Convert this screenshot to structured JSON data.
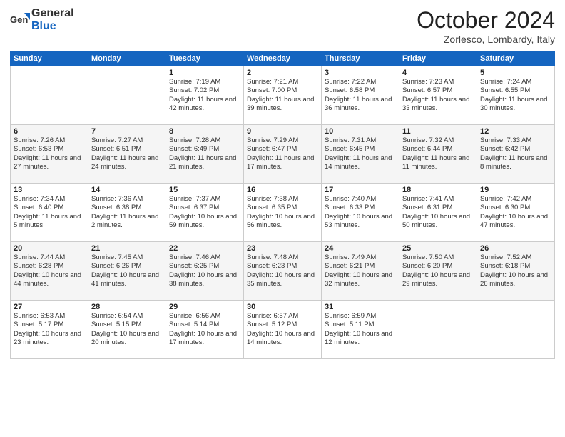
{
  "header": {
    "logo_line1": "General",
    "logo_line2": "Blue",
    "month": "October 2024",
    "location": "Zorlesco, Lombardy, Italy"
  },
  "days_of_week": [
    "Sunday",
    "Monday",
    "Tuesday",
    "Wednesday",
    "Thursday",
    "Friday",
    "Saturday"
  ],
  "weeks": [
    [
      {
        "day": "",
        "data": ""
      },
      {
        "day": "",
        "data": ""
      },
      {
        "day": "1",
        "data": "Sunrise: 7:19 AM\nSunset: 7:02 PM\nDaylight: 11 hours and 42 minutes."
      },
      {
        "day": "2",
        "data": "Sunrise: 7:21 AM\nSunset: 7:00 PM\nDaylight: 11 hours and 39 minutes."
      },
      {
        "day": "3",
        "data": "Sunrise: 7:22 AM\nSunset: 6:58 PM\nDaylight: 11 hours and 36 minutes."
      },
      {
        "day": "4",
        "data": "Sunrise: 7:23 AM\nSunset: 6:57 PM\nDaylight: 11 hours and 33 minutes."
      },
      {
        "day": "5",
        "data": "Sunrise: 7:24 AM\nSunset: 6:55 PM\nDaylight: 11 hours and 30 minutes."
      }
    ],
    [
      {
        "day": "6",
        "data": "Sunrise: 7:26 AM\nSunset: 6:53 PM\nDaylight: 11 hours and 27 minutes."
      },
      {
        "day": "7",
        "data": "Sunrise: 7:27 AM\nSunset: 6:51 PM\nDaylight: 11 hours and 24 minutes."
      },
      {
        "day": "8",
        "data": "Sunrise: 7:28 AM\nSunset: 6:49 PM\nDaylight: 11 hours and 21 minutes."
      },
      {
        "day": "9",
        "data": "Sunrise: 7:29 AM\nSunset: 6:47 PM\nDaylight: 11 hours and 17 minutes."
      },
      {
        "day": "10",
        "data": "Sunrise: 7:31 AM\nSunset: 6:45 PM\nDaylight: 11 hours and 14 minutes."
      },
      {
        "day": "11",
        "data": "Sunrise: 7:32 AM\nSunset: 6:44 PM\nDaylight: 11 hours and 11 minutes."
      },
      {
        "day": "12",
        "data": "Sunrise: 7:33 AM\nSunset: 6:42 PM\nDaylight: 11 hours and 8 minutes."
      }
    ],
    [
      {
        "day": "13",
        "data": "Sunrise: 7:34 AM\nSunset: 6:40 PM\nDaylight: 11 hours and 5 minutes."
      },
      {
        "day": "14",
        "data": "Sunrise: 7:36 AM\nSunset: 6:38 PM\nDaylight: 11 hours and 2 minutes."
      },
      {
        "day": "15",
        "data": "Sunrise: 7:37 AM\nSunset: 6:37 PM\nDaylight: 10 hours and 59 minutes."
      },
      {
        "day": "16",
        "data": "Sunrise: 7:38 AM\nSunset: 6:35 PM\nDaylight: 10 hours and 56 minutes."
      },
      {
        "day": "17",
        "data": "Sunrise: 7:40 AM\nSunset: 6:33 PM\nDaylight: 10 hours and 53 minutes."
      },
      {
        "day": "18",
        "data": "Sunrise: 7:41 AM\nSunset: 6:31 PM\nDaylight: 10 hours and 50 minutes."
      },
      {
        "day": "19",
        "data": "Sunrise: 7:42 AM\nSunset: 6:30 PM\nDaylight: 10 hours and 47 minutes."
      }
    ],
    [
      {
        "day": "20",
        "data": "Sunrise: 7:44 AM\nSunset: 6:28 PM\nDaylight: 10 hours and 44 minutes."
      },
      {
        "day": "21",
        "data": "Sunrise: 7:45 AM\nSunset: 6:26 PM\nDaylight: 10 hours and 41 minutes."
      },
      {
        "day": "22",
        "data": "Sunrise: 7:46 AM\nSunset: 6:25 PM\nDaylight: 10 hours and 38 minutes."
      },
      {
        "day": "23",
        "data": "Sunrise: 7:48 AM\nSunset: 6:23 PM\nDaylight: 10 hours and 35 minutes."
      },
      {
        "day": "24",
        "data": "Sunrise: 7:49 AM\nSunset: 6:21 PM\nDaylight: 10 hours and 32 minutes."
      },
      {
        "day": "25",
        "data": "Sunrise: 7:50 AM\nSunset: 6:20 PM\nDaylight: 10 hours and 29 minutes."
      },
      {
        "day": "26",
        "data": "Sunrise: 7:52 AM\nSunset: 6:18 PM\nDaylight: 10 hours and 26 minutes."
      }
    ],
    [
      {
        "day": "27",
        "data": "Sunrise: 6:53 AM\nSunset: 5:17 PM\nDaylight: 10 hours and 23 minutes."
      },
      {
        "day": "28",
        "data": "Sunrise: 6:54 AM\nSunset: 5:15 PM\nDaylight: 10 hours and 20 minutes."
      },
      {
        "day": "29",
        "data": "Sunrise: 6:56 AM\nSunset: 5:14 PM\nDaylight: 10 hours and 17 minutes."
      },
      {
        "day": "30",
        "data": "Sunrise: 6:57 AM\nSunset: 5:12 PM\nDaylight: 10 hours and 14 minutes."
      },
      {
        "day": "31",
        "data": "Sunrise: 6:59 AM\nSunset: 5:11 PM\nDaylight: 10 hours and 12 minutes."
      },
      {
        "day": "",
        "data": ""
      },
      {
        "day": "",
        "data": ""
      }
    ]
  ]
}
